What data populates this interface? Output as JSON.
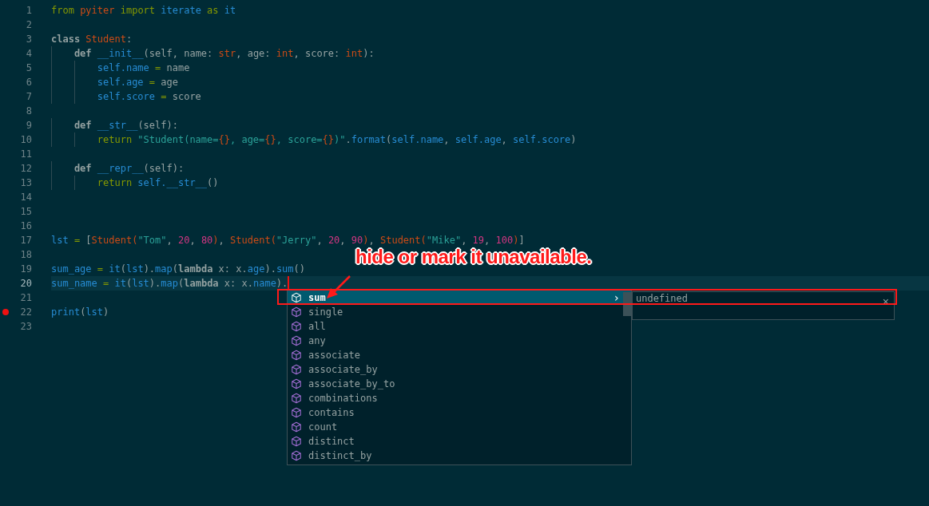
{
  "editor": {
    "lines": [
      {
        "number": "1",
        "tokens": [
          {
            "kind": "kw",
            "text": "from"
          },
          {
            "kind": "ty",
            "text": " pyiter"
          },
          {
            "kind": "kw",
            "text": " import"
          },
          {
            "kind": "id",
            "text": " iterate"
          },
          {
            "kind": "kw",
            "text": " as"
          },
          {
            "kind": "id",
            "text": " it"
          }
        ]
      },
      {
        "number": "2"
      },
      {
        "number": "3",
        "tokens": [
          {
            "kind": "bd",
            "text": "class"
          },
          {
            "kind": "ty",
            "text": " Student"
          },
          {
            "kind": "pl",
            "text": ":"
          }
        ]
      },
      {
        "number": "4",
        "tokens": [
          {
            "kind": "bd",
            "text": "    def"
          },
          {
            "kind": "id",
            "text": " __init__"
          },
          {
            "kind": "pl",
            "text": "(self, name:"
          },
          {
            "kind": "ty",
            "text": " str"
          },
          {
            "kind": "pl",
            "text": ", age:"
          },
          {
            "kind": "ty",
            "text": " int"
          },
          {
            "kind": "pl",
            "text": ", score:"
          },
          {
            "kind": "ty",
            "text": " int"
          },
          {
            "kind": "pl",
            "text": "):"
          }
        ]
      },
      {
        "number": "5",
        "tokens": [
          {
            "kind": "id",
            "text": "        self.name"
          },
          {
            "kind": "kw",
            "text": " ="
          },
          {
            "kind": "pl",
            "text": " name"
          }
        ]
      },
      {
        "number": "6",
        "tokens": [
          {
            "kind": "id",
            "text": "        self.age"
          },
          {
            "kind": "kw",
            "text": " ="
          },
          {
            "kind": "pl",
            "text": " age"
          }
        ]
      },
      {
        "number": "7",
        "tokens": [
          {
            "kind": "id",
            "text": "        self.score"
          },
          {
            "kind": "kw",
            "text": " ="
          },
          {
            "kind": "pl",
            "text": " score"
          }
        ]
      },
      {
        "number": "8"
      },
      {
        "number": "9",
        "tokens": [
          {
            "kind": "bd",
            "text": "    def"
          },
          {
            "kind": "id",
            "text": " __str__"
          },
          {
            "kind": "pl",
            "text": "(self):"
          }
        ]
      },
      {
        "number": "10",
        "tokens": [
          {
            "kind": "kw",
            "text": "        return"
          },
          {
            "kind": "st",
            "text": " \"Student(name="
          },
          {
            "kind": "ty",
            "text": "{}"
          },
          {
            "kind": "st",
            "text": ", age="
          },
          {
            "kind": "ty",
            "text": "{}"
          },
          {
            "kind": "st",
            "text": ", score="
          },
          {
            "kind": "ty",
            "text": "{}"
          },
          {
            "kind": "st",
            "text": ")\""
          },
          {
            "kind": "pl",
            "text": "."
          },
          {
            "kind": "id",
            "text": "format"
          },
          {
            "kind": "pl",
            "text": "("
          },
          {
            "kind": "id",
            "text": "self.name"
          },
          {
            "kind": "pl",
            "text": ","
          },
          {
            "kind": "id",
            "text": " self.age"
          },
          {
            "kind": "pl",
            "text": ","
          },
          {
            "kind": "id",
            "text": " self.score"
          },
          {
            "kind": "pl",
            "text": ")"
          }
        ]
      },
      {
        "number": "11"
      },
      {
        "number": "12",
        "tokens": [
          {
            "kind": "bd",
            "text": "    def"
          },
          {
            "kind": "id",
            "text": " __repr__"
          },
          {
            "kind": "pl",
            "text": "(self):"
          }
        ]
      },
      {
        "number": "13",
        "tokens": [
          {
            "kind": "kw",
            "text": "        return"
          },
          {
            "kind": "id",
            "text": " self.__str__"
          },
          {
            "kind": "pl",
            "text": "()"
          }
        ]
      },
      {
        "number": "14"
      },
      {
        "number": "15"
      },
      {
        "number": "16"
      },
      {
        "number": "17",
        "tokens": [
          {
            "kind": "id",
            "text": "lst"
          },
          {
            "kind": "kw",
            "text": " ="
          },
          {
            "kind": "pl",
            "text": " ["
          },
          {
            "kind": "ty",
            "text": "Student("
          },
          {
            "kind": "st",
            "text": "\"Tom\""
          },
          {
            "kind": "pl",
            "text": ","
          },
          {
            "kind": "nu",
            "text": " 20"
          },
          {
            "kind": "pl",
            "text": ","
          },
          {
            "kind": "nu",
            "text": " 80"
          },
          {
            "kind": "ty",
            "text": ")"
          },
          {
            "kind": "pl",
            "text": ","
          },
          {
            "kind": "ty",
            "text": " Student("
          },
          {
            "kind": "st",
            "text": "\"Jerry\""
          },
          {
            "kind": "pl",
            "text": ","
          },
          {
            "kind": "nu",
            "text": " 20"
          },
          {
            "kind": "pl",
            "text": ","
          },
          {
            "kind": "nu",
            "text": " 90"
          },
          {
            "kind": "ty",
            "text": ")"
          },
          {
            "kind": "pl",
            "text": ","
          },
          {
            "kind": "ty",
            "text": " Student("
          },
          {
            "kind": "st",
            "text": "\"Mike\""
          },
          {
            "kind": "pl",
            "text": ","
          },
          {
            "kind": "nu",
            "text": " 19"
          },
          {
            "kind": "pl",
            "text": ","
          },
          {
            "kind": "nu",
            "text": " 100"
          },
          {
            "kind": "ty",
            "text": ")"
          },
          {
            "kind": "pl",
            "text": "]"
          }
        ]
      },
      {
        "number": "18"
      },
      {
        "number": "19",
        "tokens": [
          {
            "kind": "id",
            "text": "sum_age"
          },
          {
            "kind": "kw",
            "text": " ="
          },
          {
            "kind": "id",
            "text": " it"
          },
          {
            "kind": "pl",
            "text": "("
          },
          {
            "kind": "id",
            "text": "lst"
          },
          {
            "kind": "pl",
            "text": ")."
          },
          {
            "kind": "id",
            "text": "map"
          },
          {
            "kind": "pl",
            "text": "("
          },
          {
            "kind": "bd",
            "text": "lambda"
          },
          {
            "kind": "pl",
            "text": " x: x."
          },
          {
            "kind": "id",
            "text": "age"
          },
          {
            "kind": "pl",
            "text": ")."
          },
          {
            "kind": "id",
            "text": "sum"
          },
          {
            "kind": "pl",
            "text": "()"
          }
        ]
      },
      {
        "number": "20",
        "current": true,
        "tokens": [
          {
            "kind": "id",
            "text": "sum_name"
          },
          {
            "kind": "kw",
            "text": " ="
          },
          {
            "kind": "id",
            "text": " it"
          },
          {
            "kind": "pl",
            "text": "("
          },
          {
            "kind": "id",
            "text": "lst"
          },
          {
            "kind": "pl",
            "text": ")."
          },
          {
            "kind": "id",
            "text": "map"
          },
          {
            "kind": "pl",
            "text": "("
          },
          {
            "kind": "bd",
            "text": "lambda"
          },
          {
            "kind": "pl",
            "text": " x: x."
          },
          {
            "kind": "id",
            "text": "name"
          },
          {
            "kind": "pl",
            "text": ")."
          }
        ]
      },
      {
        "number": "21"
      },
      {
        "number": "22",
        "breakpoint": true,
        "tokens": [
          {
            "kind": "id",
            "text": "print"
          },
          {
            "kind": "pl",
            "text": "("
          },
          {
            "kind": "id",
            "text": "lst"
          },
          {
            "kind": "pl",
            "text": ")"
          }
        ]
      },
      {
        "number": "23"
      }
    ]
  },
  "suggestions": {
    "items": [
      {
        "label": "sum",
        "selected": true
      },
      {
        "label": "single",
        "selected": false
      },
      {
        "label": "all",
        "selected": false
      },
      {
        "label": "any",
        "selected": false
      },
      {
        "label": "associate",
        "selected": false
      },
      {
        "label": "associate_by",
        "selected": false
      },
      {
        "label": "associate_by_to",
        "selected": false
      },
      {
        "label": "combinations",
        "selected": false
      },
      {
        "label": "contains",
        "selected": false
      },
      {
        "label": "count",
        "selected": false
      },
      {
        "label": "distinct",
        "selected": false
      },
      {
        "label": "distinct_by",
        "selected": false
      }
    ],
    "expand_symbol": "›",
    "detail": {
      "text": "undefined",
      "close": "×"
    }
  },
  "annotation": {
    "text": "hide or mark it unavailable."
  }
}
